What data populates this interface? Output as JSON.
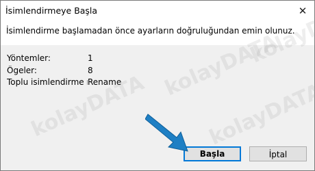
{
  "dialog": {
    "title": "İsimlendirmeye Başla",
    "close_glyph": "✕",
    "message": "İsimlendirme başlamadan önce ayarların doğruluğundan emin olunuz."
  },
  "details": {
    "rows": [
      {
        "label": "Yöntemler:",
        "value": "1"
      },
      {
        "label": "Ögeler:",
        "value": "8"
      },
      {
        "label": "Toplu isimlendirme m",
        "value": "Rename"
      }
    ]
  },
  "buttons": {
    "start_label": "Başla",
    "cancel_label": "İptal"
  },
  "watermark": {
    "brand_a": "kolay",
    "brand_b": "DATA"
  },
  "colors": {
    "accent": "#0078d7",
    "arrow": "#1e7fc4"
  }
}
